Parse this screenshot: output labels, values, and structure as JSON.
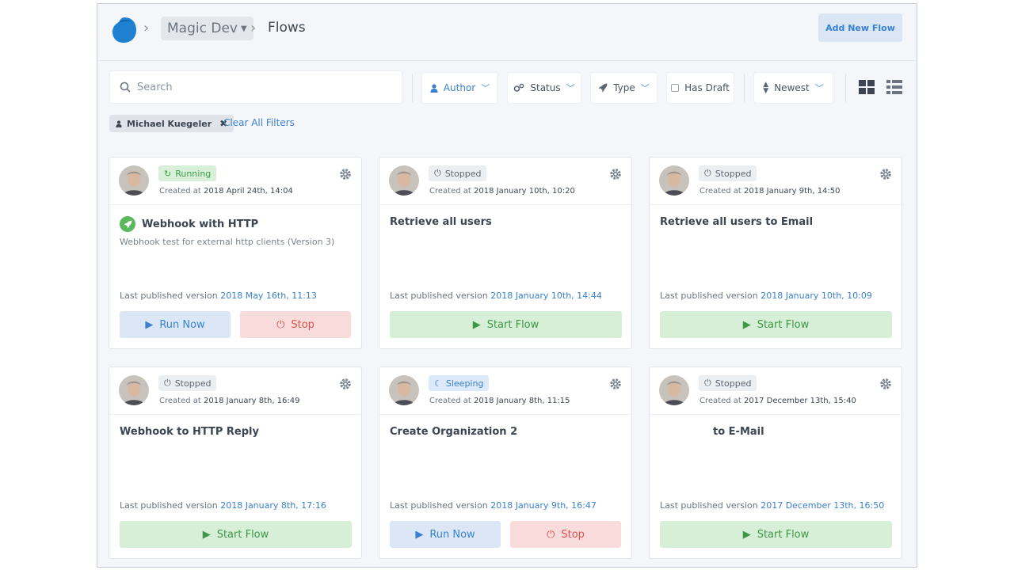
{
  "header": {
    "environment": "Magic Dev",
    "page": "Flows",
    "add_flow_label": "Add New Flow"
  },
  "filters": {
    "search_placeholder": "Search",
    "author_label": "Author",
    "status_label": "Status",
    "type_label": "Type",
    "has_draft_label": "Has Draft",
    "sort_label": "Newest",
    "active_chip": "Michael Kuegeler",
    "clear_all": "Clear All Filters"
  },
  "colors": {
    "accent": "#3a82cf",
    "running": "#3f9e4a",
    "stop": "#d9534f",
    "start_bg": "#d6efd6"
  },
  "labels": {
    "created_prefix": "Created at",
    "published_prefix": "Last published version",
    "run_now": "Run Now",
    "stop": "Stop",
    "start_flow": "Start Flow"
  },
  "cards": [
    {
      "status": "Running",
      "created": "2018 April 24th, 14:04",
      "title": "Webhook with HTTP",
      "description": "Webhook test for external http clients (Version 3)",
      "published": "2018 May 16th, 11:13"
    },
    {
      "status": "Stopped",
      "created": "2018 January 10th, 10:20",
      "title": "Retrieve all users",
      "description": "",
      "published": "2018 January 10th, 14:44"
    },
    {
      "status": "Stopped",
      "created": "2018 January 9th, 14:50",
      "title": "Retrieve all users to Email",
      "description": "",
      "published": "2018 January 10th, 10:09"
    },
    {
      "status": "Stopped",
      "created": "2018 January 8th, 16:49",
      "title": "Webhook to HTTP Reply",
      "description": "",
      "published": "2018 January 8th, 17:16"
    },
    {
      "status": "Sleeping",
      "created": "2018 January 8th, 11:15",
      "title": "Create Organization 2",
      "description": "",
      "published": "2018 January 9th, 16:47"
    },
    {
      "status": "Stopped",
      "created": "2017 December 13th, 15:40",
      "title": "to E-Mail",
      "description": "",
      "published": "2017 December 13th, 16:50"
    }
  ]
}
